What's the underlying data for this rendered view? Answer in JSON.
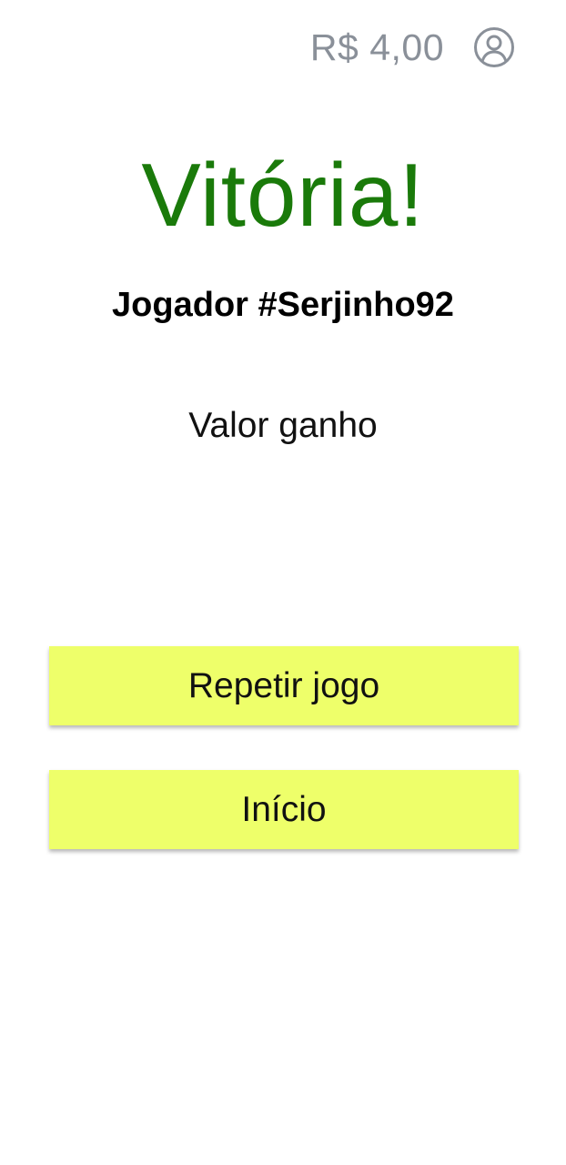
{
  "header": {
    "balance": "R$ 4,00",
    "profile_icon": "user-circle-icon"
  },
  "result": {
    "title": "Vitória!",
    "player": "Jogador #Serjinho92",
    "value_label": "Valor ganho"
  },
  "actions": {
    "repeat_label": "Repetir jogo",
    "home_label": "Início"
  },
  "colors": {
    "title": "#1a7a0a",
    "button_bg": "#eeff6a",
    "header_text": "#8a9099"
  }
}
